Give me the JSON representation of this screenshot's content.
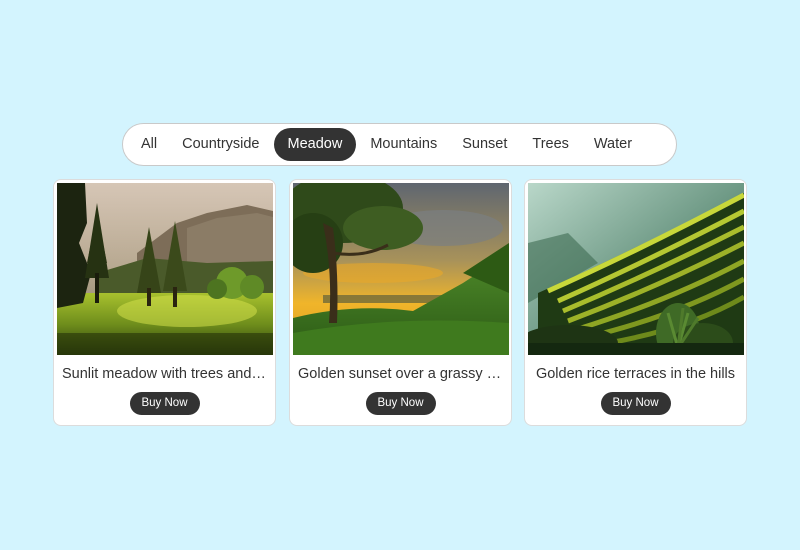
{
  "filters": {
    "items": [
      {
        "label": "All",
        "active": false
      },
      {
        "label": "Countryside",
        "active": false
      },
      {
        "label": "Meadow",
        "active": true
      },
      {
        "label": "Mountains",
        "active": false
      },
      {
        "label": "Sunset",
        "active": false
      },
      {
        "label": "Trees",
        "active": false
      },
      {
        "label": "Water",
        "active": false
      }
    ]
  },
  "cards": [
    {
      "caption": "Sunlit meadow with trees and a mountain backdrop",
      "button_label": "Buy Now",
      "image": "sunlit-meadow-photo"
    },
    {
      "caption": "Golden sunset over a grassy hillside",
      "button_label": "Buy Now",
      "image": "golden-sunset-photo"
    },
    {
      "caption": "Golden rice terraces in the hills",
      "button_label": "Buy Now",
      "image": "rice-terraces-photo"
    }
  ],
  "colors": {
    "background": "#d3f4fe",
    "active_pill": "#333333",
    "button": "#333333"
  }
}
